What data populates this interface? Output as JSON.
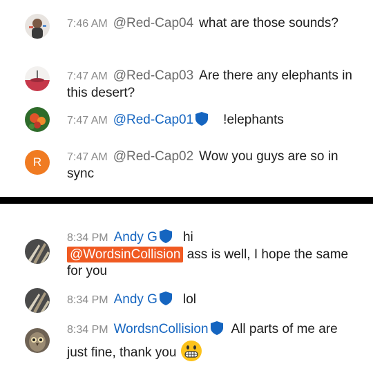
{
  "messages_top": [
    {
      "time": "7:46 AM",
      "author": "@Red-Cap04",
      "body": "what are those sounds?"
    },
    {
      "time": "7:47 AM",
      "author": "@Red-Cap03",
      "body": "Are there any elephants in this desert?"
    },
    {
      "time": "7:47 AM",
      "author": "@Red-Cap01",
      "body": "!elephants",
      "verified": true
    },
    {
      "time": "7:47 AM",
      "author": "@Red-Cap02",
      "body": "Wow you guys are so in sync",
      "avatar_letter": "R"
    }
  ],
  "messages_bottom": [
    {
      "time": "8:34 PM",
      "author": "Andy G",
      "body_start": "hi",
      "mention": "@WordsinCollision",
      "body_end": "ass is well, I hope the same for you"
    },
    {
      "time": "8:34 PM",
      "author": "Andy G",
      "body": "lol"
    },
    {
      "time": "8:34 PM",
      "author": "WordsnCollision",
      "body": "All parts of me are just fine, thank you"
    }
  ],
  "colors": {
    "mention_bg": "#f05a22",
    "author_blue": "#1565c0",
    "badge": "#1565c0",
    "avatar_r": "#f07b22"
  },
  "icons": {
    "verified": "shield-icon",
    "emoji": "grinning-face-icon"
  }
}
